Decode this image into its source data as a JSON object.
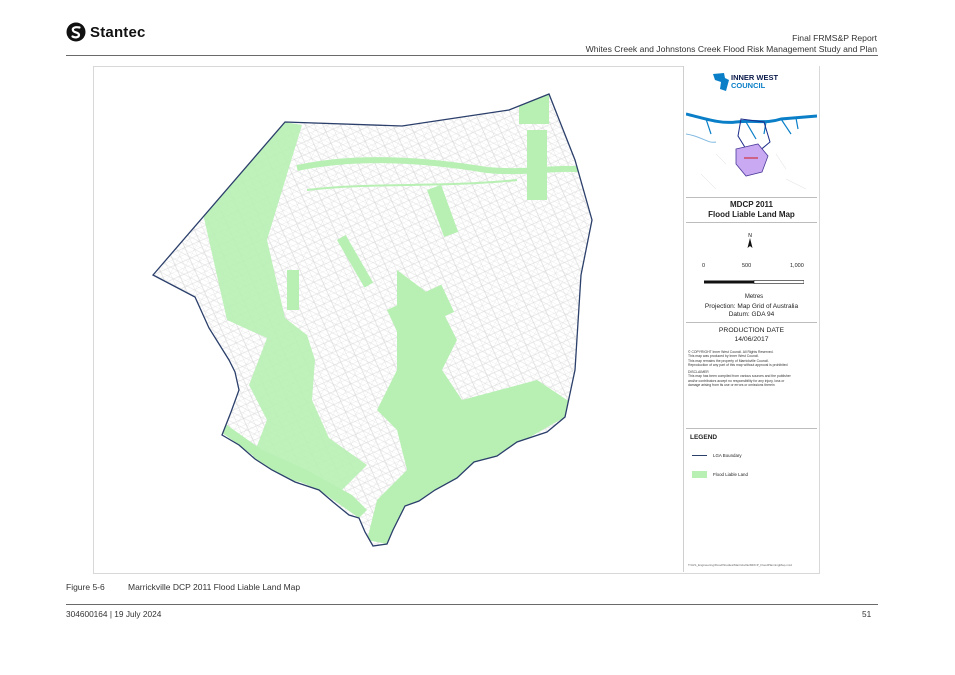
{
  "header": {
    "brand": "Stantec",
    "report_title": "Final FRMS&P Report",
    "report_subtitle": "Whites Creek and Johnstons Creek Flood Risk Management Study and Plan"
  },
  "map_panel": {
    "council_line1": "INNER WEST",
    "council_line2": "COUNCIL",
    "map_title_line1": "MDCP 2011",
    "map_title_line2": "Flood Liable Land Map",
    "north_label": "N",
    "scale_ticks": [
      "0",
      "500",
      "1,000"
    ],
    "scale_unit": "Metres",
    "projection": "Projection: Map Grid of Australia",
    "datum": "Datum: GDA 94",
    "production_label": "PRODUCTION DATE",
    "production_date": "14/06/2017",
    "copyright_lines": [
      "© COPYRIGHT   Inner West Council.  All Rights Reserved.",
      "This map was produced by Inner West Council.",
      "This map remains the property of Marrickville Council.",
      "Reproduction of any part of this map without approval is prohibited"
    ],
    "disclaimer_heading": "DISCLAIMER",
    "disclaimer_lines": [
      "This map has been compiled from various sources and the publisher",
      "and/or contributors accept no responsibility for any injury, loss or",
      "damage arising from its use or errors or omissions therein"
    ],
    "legend_heading": "LEGEND",
    "legend_items": [
      {
        "label": "LGA Boundary",
        "kind": "line"
      },
      {
        "label": "Flood Liable Land",
        "kind": "fill"
      }
    ],
    "file_path": "T:\\GIS_Engineering\\Flood\\Studies\\Marrickville\\MDCP_FloodPlanningMap.mxd"
  },
  "colors": {
    "flood_fill": "#b8f0b4",
    "boundary": "#2b3f6b",
    "council_blue": "#0a7fc8"
  },
  "caption": {
    "number": "Figure 5-6",
    "text": "Marrickville DCP 2011 Flood Liable Land Map"
  },
  "footer": {
    "doc_ref": "304600164 | 19 July 2024",
    "page": "51"
  }
}
